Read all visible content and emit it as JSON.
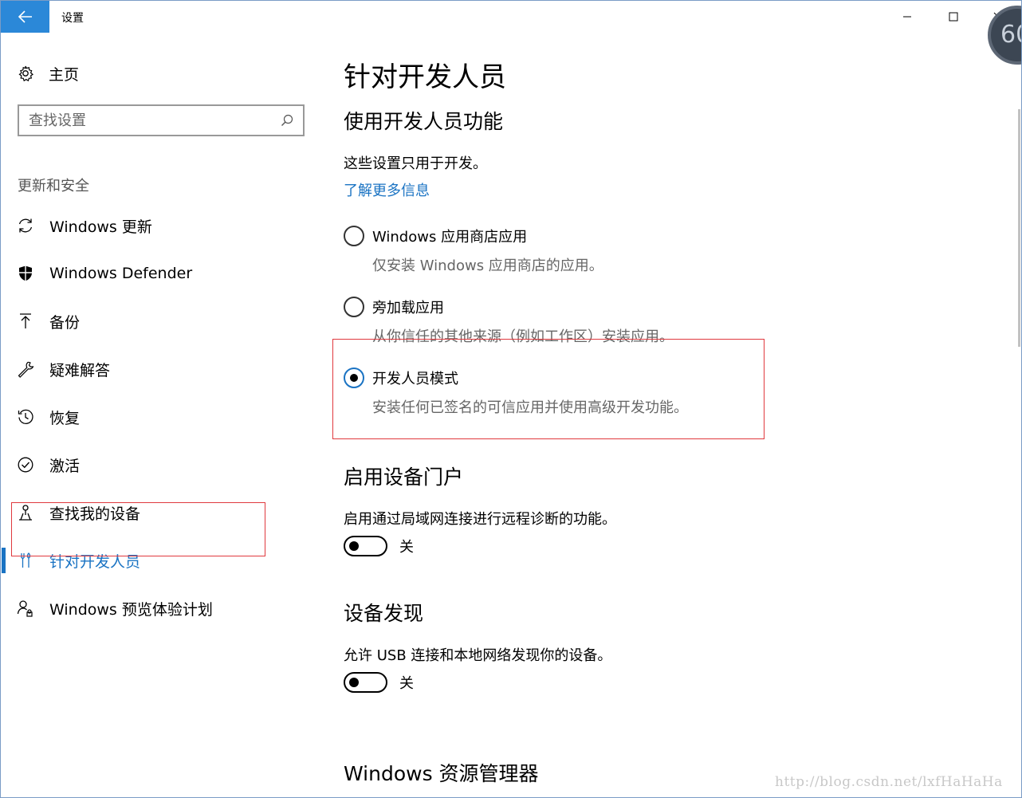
{
  "window": {
    "title": "设置",
    "accent": "#2b88d8",
    "badge": "60"
  },
  "sidebar": {
    "home_label": "主页",
    "search_placeholder": "查找设置",
    "section_label": "更新和安全",
    "items": [
      {
        "icon": "sync-icon",
        "label": "Windows 更新"
      },
      {
        "icon": "shield-icon",
        "label": "Windows Defender"
      },
      {
        "icon": "backup-arrow-icon",
        "label": "备份"
      },
      {
        "icon": "wrench-icon",
        "label": "疑难解答"
      },
      {
        "icon": "history-icon",
        "label": "恢复"
      },
      {
        "icon": "check-circle-icon",
        "label": "激活"
      },
      {
        "icon": "find-device-icon",
        "label": "查找我的设备"
      },
      {
        "icon": "developer-tools-icon",
        "label": "针对开发人员",
        "active": true
      },
      {
        "icon": "insider-person-icon",
        "label": "Windows 预览体验计划"
      }
    ]
  },
  "main": {
    "page_title": "针对开发人员",
    "dev_features": {
      "heading": "使用开发人员功能",
      "desc": "这些设置只用于开发。",
      "link": "了解更多信息",
      "options": [
        {
          "label": "Windows 应用商店应用",
          "desc": "仅安装 Windows 应用商店的应用。",
          "checked": false
        },
        {
          "label": "旁加载应用",
          "desc": "从你信任的其他来源（例如工作区）安装应用。",
          "checked": false
        },
        {
          "label": "开发人员模式",
          "desc": "安装任何已签名的可信应用并使用高级开发功能。",
          "checked": true
        }
      ]
    },
    "device_portal": {
      "heading": "启用设备门户",
      "desc": "启用通过局域网连接进行远程诊断的功能。",
      "toggle_state": "关"
    },
    "device_discovery": {
      "heading": "设备发现",
      "desc": "允许 USB 连接和本地网络发现你的设备。",
      "toggle_state": "关"
    },
    "explorer": {
      "heading": "Windows 资源管理器"
    }
  },
  "watermark": "http://blog.csdn.net/lxfHaHaHa",
  "colors": {
    "link": "#1a73c3",
    "highlight_box": "#e0393e"
  }
}
